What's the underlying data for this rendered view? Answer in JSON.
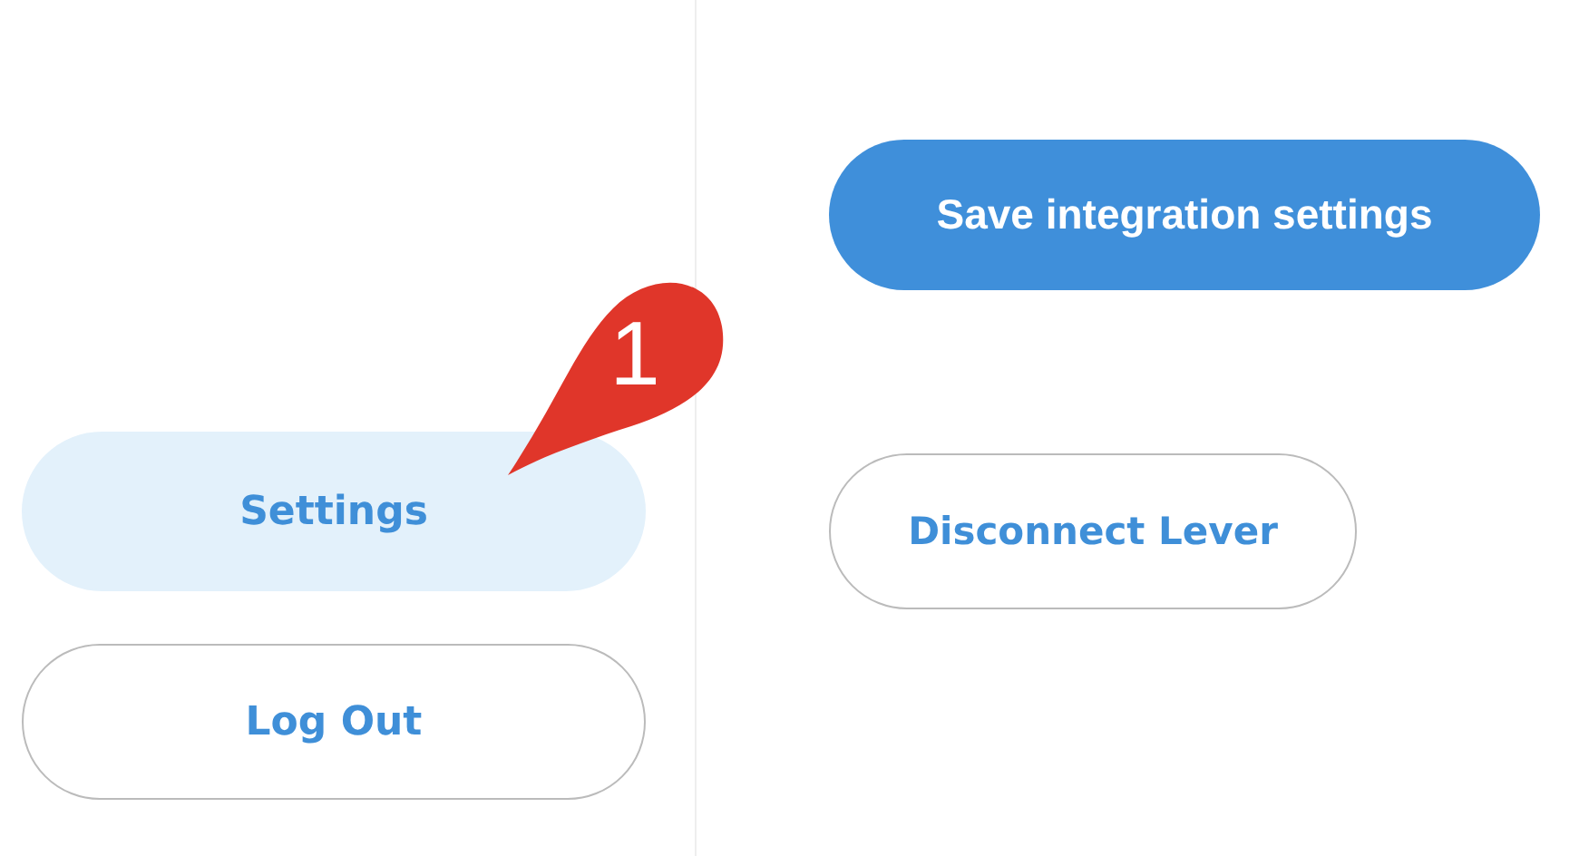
{
  "sidebar": {
    "items": [
      {
        "label": "Settings",
        "selected": true
      },
      {
        "label": "Log Out",
        "selected": false
      }
    ]
  },
  "actions": [
    {
      "label": "Save integration settings",
      "kind": "primary"
    },
    {
      "label": "Disconnect Lever",
      "kind": "outline"
    }
  ],
  "callout": {
    "label": "1"
  }
}
